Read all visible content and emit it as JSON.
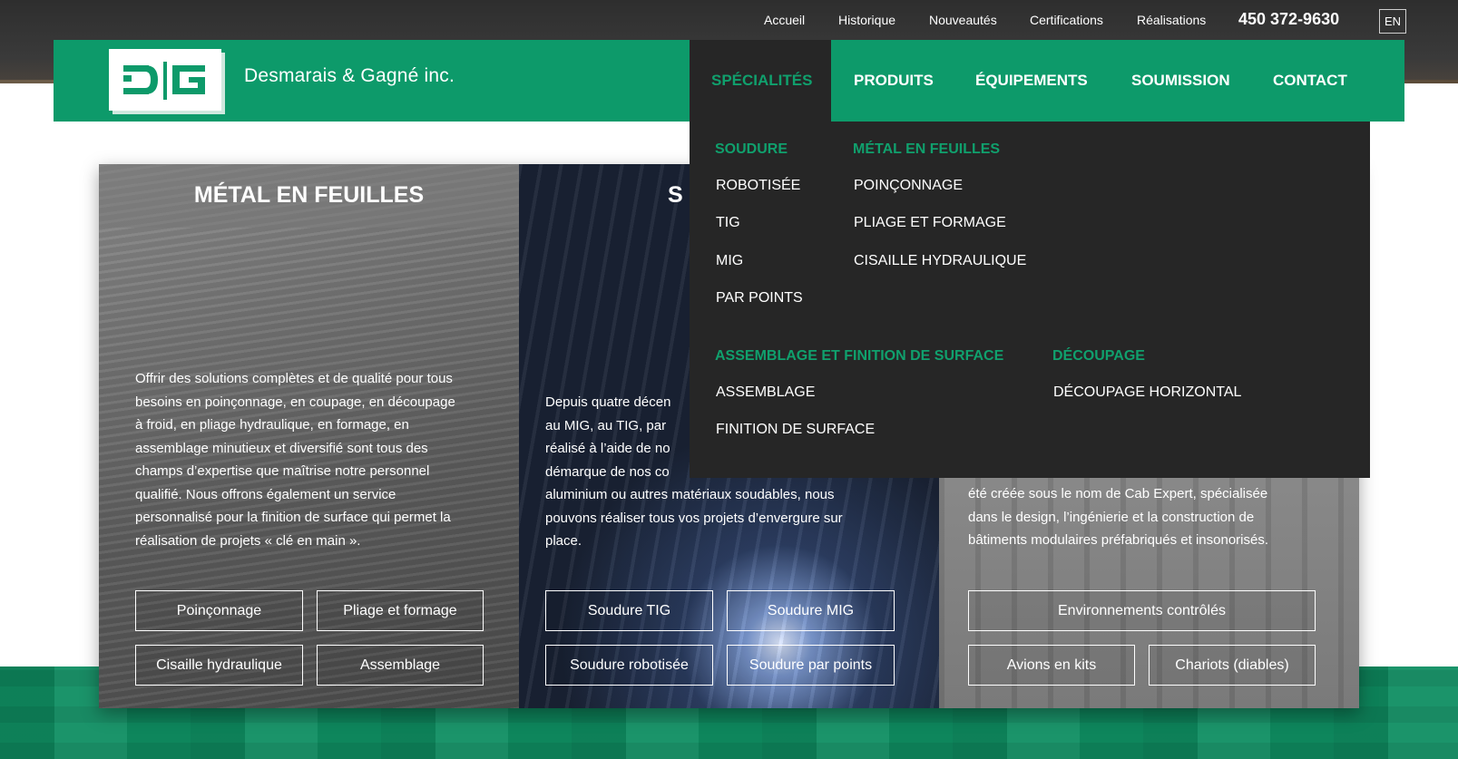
{
  "colors": {
    "brand_green": "#0d9a6a",
    "menu_dark": "#262626",
    "menu_heading": "#10a06d",
    "utility_bar": "#2e2e2e"
  },
  "utility_nav": {
    "items": [
      "Accueil",
      "Historique",
      "Nouveautés",
      "Certifications",
      "Réalisations"
    ],
    "phone": "450 372-9630",
    "lang": "EN"
  },
  "brand": {
    "logo_text": "DG",
    "company_name": "Desmarais & Gagné inc."
  },
  "main_nav": {
    "items": [
      "SPÉCIALITÉS",
      "PRODUITS",
      "ÉQUIPEMENTS",
      "SOUMISSION",
      "CONTACT"
    ],
    "active": "SPÉCIALITÉS"
  },
  "dropdown": {
    "soudure": {
      "heading": "SOUDURE",
      "links": [
        "ROBOTISÉE",
        "TIG",
        "MIG",
        "PAR POINTS"
      ]
    },
    "metal": {
      "heading": "MÉTAL EN FEUILLES",
      "links": [
        "POINÇONNAGE",
        "PLIAGE ET FORMAGE",
        "CISAILLE HYDRAULIQUE"
      ]
    },
    "assemblage": {
      "heading": "ASSEMBLAGE ET FINITION DE SURFACE",
      "links": [
        "ASSEMBLAGE",
        "FINITION DE SURFACE"
      ]
    },
    "decoupage": {
      "heading": "DÉCOUPAGE",
      "links": [
        "DÉCOUPAGE HORIZONTAL"
      ]
    }
  },
  "cards": {
    "metal": {
      "title": "MÉTAL EN FEUILLES",
      "lines": [
        "Offrir des solutions complètes et de qualité pour tous",
        "besoins en poinçonnage, en coupage, en découpage",
        "à froid, en pliage hydraulique, en formage, en",
        "assemblage minutieux et diversifié sont tous des",
        "champs d’expertise que maîtrise notre personnel",
        "qualifié. Nous offrons également un service",
        "personnalisé pour la finition de surface qui permet la",
        "réalisation de projets « clé en main »."
      ],
      "buttons": [
        "Poinçonnage",
        "Pliage et formage",
        "Cisaille hydraulique",
        "Assemblage"
      ]
    },
    "soudure": {
      "title": "S",
      "lines": [
        "Depuis quatre décen",
        "au MIG, au TIG, par",
        "réalisé à l’aide de no",
        "démarque de nos co",
        "aluminium ou autres matériaux soudables, nous",
        "pouvons réaliser tous vos projets d’envergure sur",
        "place."
      ],
      "buttons": [
        "Soudure TIG",
        "Soudure MIG",
        "Soudure robotisée",
        "Soudure par points"
      ]
    },
    "autres": {
      "lines": [
        "été créée sous le nom de Cab Expert, spécialisée",
        "dans le design, l’ingénierie et la construction de",
        "bâtiments modulaires préfabriqués et insonorisés."
      ],
      "buttons": [
        "Environnements contrôlés",
        "Avions en kits",
        "Chariots (diables)"
      ]
    }
  }
}
